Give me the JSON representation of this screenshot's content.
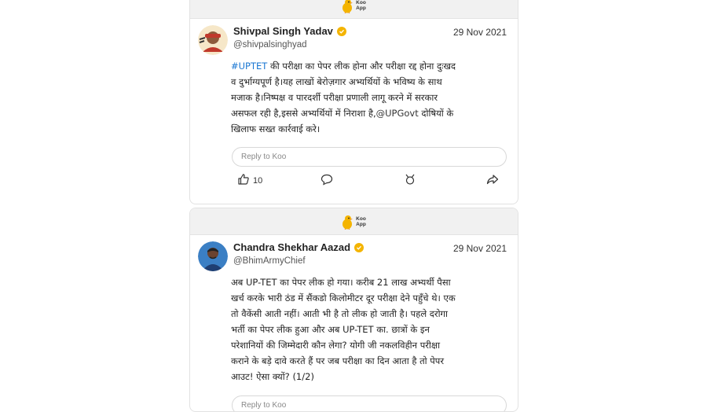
{
  "posts": [
    {
      "header_brand": {
        "line1": "Koo",
        "line2": "App"
      },
      "author": "Shivpal Singh Yadav",
      "handle": "@shivpalsinghyad",
      "date": "29 Nov 2021",
      "hashtag": "#UPTET",
      "text_line1": " की परीक्षा का पेपर लीक होना और परीक्षा रद्द होना दुःखद",
      "text_line2": "व दुर्भाग्यपूर्ण है।यह लाखों बेरोज़गार अभ्यर्थियों के भविष्य के साथ",
      "text_line3": "मजाक है।निष्पक्ष व पारदर्शी परीक्षा प्रणाली लागू करने में सरकार",
      "text_line4a": "असफल रही है,इससे अभ्यर्थियों में निराशा है,",
      "mention": "@UPGovt",
      "text_line4b": " दोषियों के",
      "text_line5": "खिलाफ सख्त कार्रवाई करे।",
      "reply_placeholder": "Reply to Koo",
      "like_count": "10",
      "avatar_color": "#c0392b"
    },
    {
      "header_brand": {
        "line1": "Koo",
        "line2": "App"
      },
      "author": "Chandra Shekhar Aazad",
      "handle": "@BhimArmyChief",
      "date": "29 Nov 2021",
      "lines": [
        "अब UP-TET का पेपर लीक हो गया। करीब 21 लाख अभ्यर्थी पैसा",
        "खर्च करके भारी ठंड में सैंकडो किलोमीटर दूर परीक्षा देने पहुँचे थे। एक",
        "तो वैकेंसी आती नहीं। आती भी है तो लीक हो जाती है। पहले दरोगा",
        "भर्ती का पेपर लीक हुआ और अब UP-TET का. छात्रों के इन",
        "परेशानियों की जिम्मेदारी कौन लेगा? योगी जी नकलविहीन परीक्षा",
        "कराने के बड़े दावे करते हैं पर जब परीक्षा का दिन आता है तो पेपर",
        "आउट! ऐसा क्यों? (1/2)"
      ],
      "reply_placeholder": "Reply to Koo",
      "avatar_color": "#2c6fb0"
    }
  ],
  "colors": {
    "brand_yellow": "#f4b400",
    "hashtag_blue": "#1976d2"
  }
}
